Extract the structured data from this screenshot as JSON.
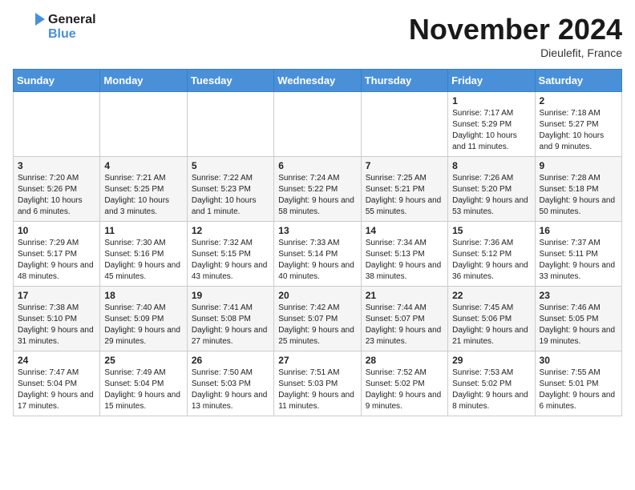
{
  "header": {
    "logo_line1": "General",
    "logo_line2": "Blue",
    "month": "November 2024",
    "location": "Dieulefit, France"
  },
  "weekdays": [
    "Sunday",
    "Monday",
    "Tuesday",
    "Wednesday",
    "Thursday",
    "Friday",
    "Saturday"
  ],
  "weeks": [
    [
      {
        "day": "",
        "info": ""
      },
      {
        "day": "",
        "info": ""
      },
      {
        "day": "",
        "info": ""
      },
      {
        "day": "",
        "info": ""
      },
      {
        "day": "",
        "info": ""
      },
      {
        "day": "1",
        "info": "Sunrise: 7:17 AM\nSunset: 5:29 PM\nDaylight: 10 hours and 11 minutes."
      },
      {
        "day": "2",
        "info": "Sunrise: 7:18 AM\nSunset: 5:27 PM\nDaylight: 10 hours and 9 minutes."
      }
    ],
    [
      {
        "day": "3",
        "info": "Sunrise: 7:20 AM\nSunset: 5:26 PM\nDaylight: 10 hours and 6 minutes."
      },
      {
        "day": "4",
        "info": "Sunrise: 7:21 AM\nSunset: 5:25 PM\nDaylight: 10 hours and 3 minutes."
      },
      {
        "day": "5",
        "info": "Sunrise: 7:22 AM\nSunset: 5:23 PM\nDaylight: 10 hours and 1 minute."
      },
      {
        "day": "6",
        "info": "Sunrise: 7:24 AM\nSunset: 5:22 PM\nDaylight: 9 hours and 58 minutes."
      },
      {
        "day": "7",
        "info": "Sunrise: 7:25 AM\nSunset: 5:21 PM\nDaylight: 9 hours and 55 minutes."
      },
      {
        "day": "8",
        "info": "Sunrise: 7:26 AM\nSunset: 5:20 PM\nDaylight: 9 hours and 53 minutes."
      },
      {
        "day": "9",
        "info": "Sunrise: 7:28 AM\nSunset: 5:18 PM\nDaylight: 9 hours and 50 minutes."
      }
    ],
    [
      {
        "day": "10",
        "info": "Sunrise: 7:29 AM\nSunset: 5:17 PM\nDaylight: 9 hours and 48 minutes."
      },
      {
        "day": "11",
        "info": "Sunrise: 7:30 AM\nSunset: 5:16 PM\nDaylight: 9 hours and 45 minutes."
      },
      {
        "day": "12",
        "info": "Sunrise: 7:32 AM\nSunset: 5:15 PM\nDaylight: 9 hours and 43 minutes."
      },
      {
        "day": "13",
        "info": "Sunrise: 7:33 AM\nSunset: 5:14 PM\nDaylight: 9 hours and 40 minutes."
      },
      {
        "day": "14",
        "info": "Sunrise: 7:34 AM\nSunset: 5:13 PM\nDaylight: 9 hours and 38 minutes."
      },
      {
        "day": "15",
        "info": "Sunrise: 7:36 AM\nSunset: 5:12 PM\nDaylight: 9 hours and 36 minutes."
      },
      {
        "day": "16",
        "info": "Sunrise: 7:37 AM\nSunset: 5:11 PM\nDaylight: 9 hours and 33 minutes."
      }
    ],
    [
      {
        "day": "17",
        "info": "Sunrise: 7:38 AM\nSunset: 5:10 PM\nDaylight: 9 hours and 31 minutes."
      },
      {
        "day": "18",
        "info": "Sunrise: 7:40 AM\nSunset: 5:09 PM\nDaylight: 9 hours and 29 minutes."
      },
      {
        "day": "19",
        "info": "Sunrise: 7:41 AM\nSunset: 5:08 PM\nDaylight: 9 hours and 27 minutes."
      },
      {
        "day": "20",
        "info": "Sunrise: 7:42 AM\nSunset: 5:07 PM\nDaylight: 9 hours and 25 minutes."
      },
      {
        "day": "21",
        "info": "Sunrise: 7:44 AM\nSunset: 5:07 PM\nDaylight: 9 hours and 23 minutes."
      },
      {
        "day": "22",
        "info": "Sunrise: 7:45 AM\nSunset: 5:06 PM\nDaylight: 9 hours and 21 minutes."
      },
      {
        "day": "23",
        "info": "Sunrise: 7:46 AM\nSunset: 5:05 PM\nDaylight: 9 hours and 19 minutes."
      }
    ],
    [
      {
        "day": "24",
        "info": "Sunrise: 7:47 AM\nSunset: 5:04 PM\nDaylight: 9 hours and 17 minutes."
      },
      {
        "day": "25",
        "info": "Sunrise: 7:49 AM\nSunset: 5:04 PM\nDaylight: 9 hours and 15 minutes."
      },
      {
        "day": "26",
        "info": "Sunrise: 7:50 AM\nSunset: 5:03 PM\nDaylight: 9 hours and 13 minutes."
      },
      {
        "day": "27",
        "info": "Sunrise: 7:51 AM\nSunset: 5:03 PM\nDaylight: 9 hours and 11 minutes."
      },
      {
        "day": "28",
        "info": "Sunrise: 7:52 AM\nSunset: 5:02 PM\nDaylight: 9 hours and 9 minutes."
      },
      {
        "day": "29",
        "info": "Sunrise: 7:53 AM\nSunset: 5:02 PM\nDaylight: 9 hours and 8 minutes."
      },
      {
        "day": "30",
        "info": "Sunrise: 7:55 AM\nSunset: 5:01 PM\nDaylight: 9 hours and 6 minutes."
      }
    ]
  ]
}
